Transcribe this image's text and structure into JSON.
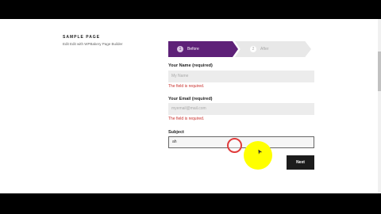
{
  "sidebar": {
    "title": "SAMPLE PAGE",
    "subtitle": "Edit Edit with WPBakery Page Builder"
  },
  "steps": [
    {
      "number": "1",
      "label": "Before",
      "active": true,
      "color": "#5e2178"
    },
    {
      "number": "2",
      "label": "After",
      "active": false
    }
  ],
  "form": {
    "name": {
      "label": "Your Name (required)",
      "placeholder": "My Name",
      "value": "",
      "error": "The field is required."
    },
    "email": {
      "label": "Your Email (required)",
      "placeholder": "myemail@mail.com",
      "value": "",
      "error": "The field is required."
    },
    "subject": {
      "label": "Subject",
      "value": "ah",
      "focused": true
    },
    "next_label": "Next"
  },
  "colors": {
    "accent": "#5e2178",
    "error": "#c9302c",
    "cursor_highlight": "#ffff00",
    "click_ring": "#e03c3c",
    "button": "#1c1c1c"
  },
  "icons": {
    "cursor": "mouse-pointer-icon"
  }
}
